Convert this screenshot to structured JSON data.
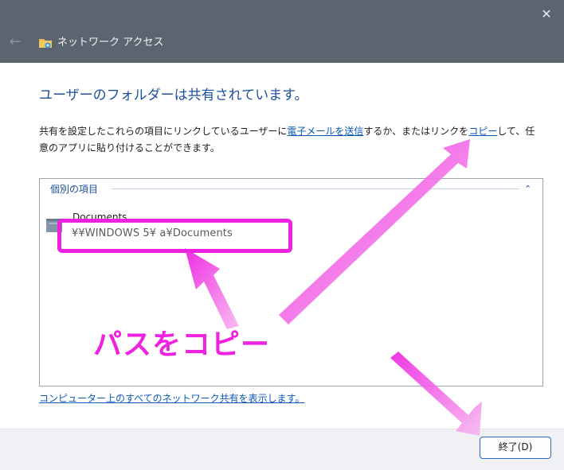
{
  "window": {
    "title": "ネットワーク アクセス",
    "close_glyph": "✕",
    "back_glyph": "←"
  },
  "main": {
    "heading": "ユーザーのフォルダーは共有されています。",
    "desc_part1": "共有を設定したこれらの項目にリンクしているユーザーに",
    "email_link": "電子メールを送信",
    "desc_part2": "するか、またはリンクを",
    "copy_link": "コピー",
    "desc_part3": "して、任意のアプリに貼り付けることができます。"
  },
  "group": {
    "title": "個別の項目",
    "collapse_glyph": "⌃",
    "item_name": "Documents",
    "item_path": "¥¥WINDOWS        5¥         a¥Documents"
  },
  "footer": {
    "show_all_link": "コンピューター上のすべてのネットワーク共有を表示します。",
    "finish_button": "終了(D)"
  },
  "annotation": {
    "label": "パスをコピー",
    "color": "#ee22e0"
  },
  "colors": {
    "titlebar": "#5c6470",
    "heading": "#1c4f9c",
    "link": "#0b57b8",
    "highlight": "#ee22e0"
  }
}
